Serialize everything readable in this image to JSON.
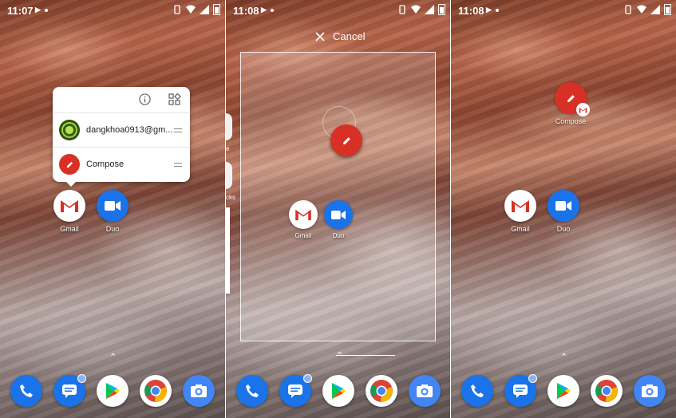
{
  "screens": [
    {
      "time": "11:07",
      "popup": {
        "account_label": "dangkhoa0913@gm...",
        "compose_label": "Compose"
      }
    },
    {
      "time": "11:08",
      "cancel_label": "Cancel",
      "peek_labels": [
        "e",
        "cks"
      ]
    },
    {
      "time": "11:08",
      "shortcut_label": "Compose"
    }
  ],
  "apps": {
    "gmail_label": "Gmail",
    "duo_label": "Duo"
  },
  "dock_icons": [
    "phone-icon",
    "messages-icon",
    "play-store-icon",
    "chrome-icon",
    "camera-icon"
  ],
  "colors": {
    "compose_red": "#d93025",
    "google_blue": "#1a73e8"
  },
  "chevron": "⌃"
}
